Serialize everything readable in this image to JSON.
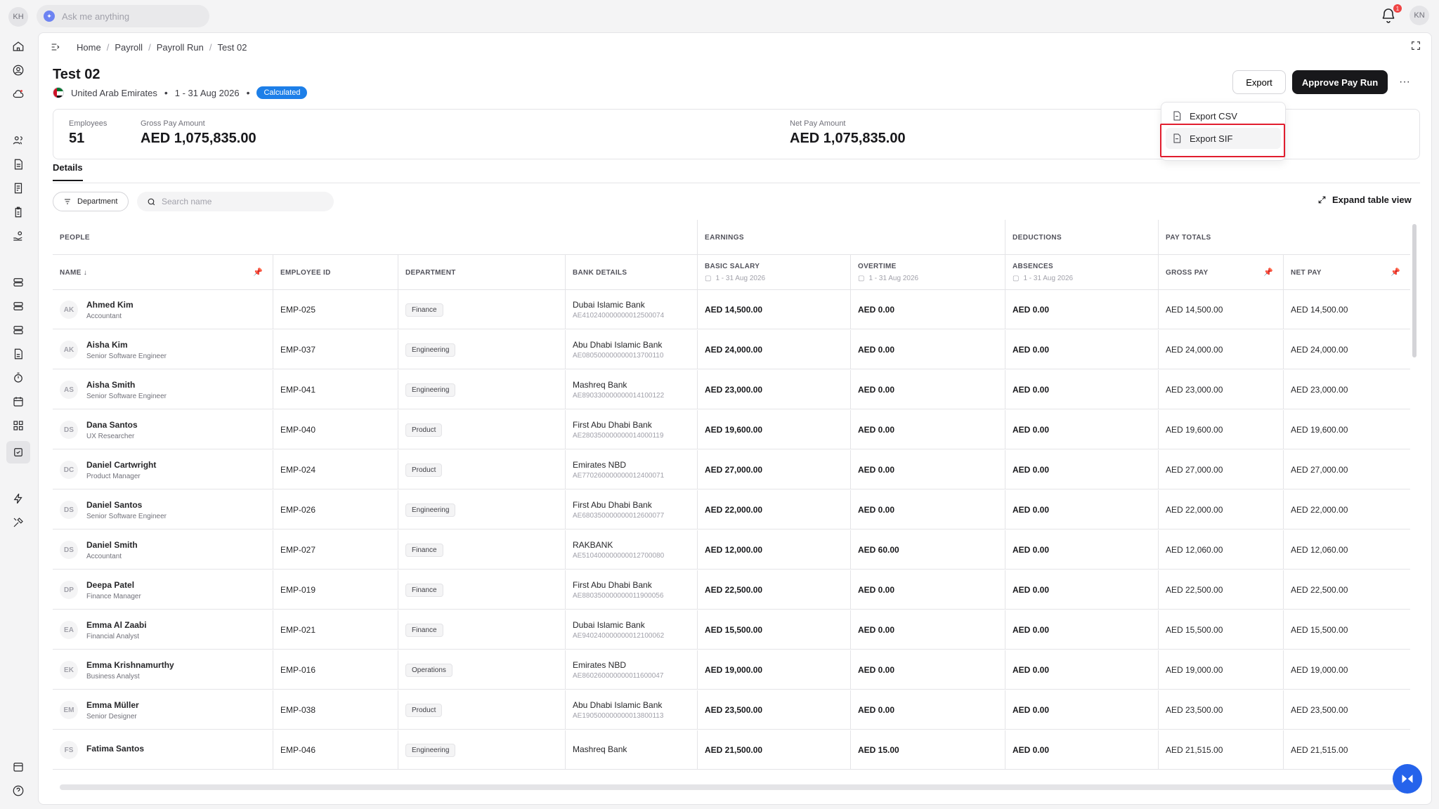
{
  "topbar": {
    "user_initials_left": "KH",
    "ask_placeholder": "Ask me anything",
    "notifications_count": "1",
    "user_initials_right": "KN"
  },
  "breadcrumb": [
    "Home",
    "Payroll",
    "Payroll Run",
    "Test 02"
  ],
  "page": {
    "title": "Test 02",
    "country": "United Arab Emirates",
    "period": "1 - 31 Aug 2026",
    "status": "Calculated"
  },
  "actions": {
    "export": "Export",
    "approve": "Approve Pay Run",
    "more": "···"
  },
  "export_menu": {
    "items": [
      {
        "label": "Export CSV"
      },
      {
        "label": "Export SIF"
      }
    ]
  },
  "summary": {
    "employees_label": "Employees",
    "employees_value": "51",
    "gross_label": "Gross Pay Amount",
    "gross_value": "AED 1,075,835.00",
    "net_label": "Net Pay Amount",
    "net_value": "AED 1,075,835.00"
  },
  "tabs": [
    "Details"
  ],
  "filters": {
    "department": "Department",
    "search_placeholder": "Search name",
    "expand": "Expand table view"
  },
  "table": {
    "groups": [
      "PEOPLE",
      "EARNINGS",
      "DEDUCTIONS",
      "PAY TOTALS"
    ],
    "headers": {
      "name": "NAME",
      "employee_id": "EMPLOYEE ID",
      "department": "DEPARTMENT",
      "bank": "BANK DETAILS",
      "basic_salary": "BASIC SALARY",
      "overtime": "OVERTIME",
      "absences": "ABSENCES",
      "gross_pay": "GROSS PAY",
      "net_pay": "NET PAY",
      "period_sub": "1 - 31 Aug 2026"
    },
    "rows": [
      {
        "initials": "AK",
        "name": "Ahmed Kim",
        "role": "Accountant",
        "id": "EMP-025",
        "dept": "Finance",
        "bank": "Dubai Islamic Bank",
        "iban": "AE410240000000012500074",
        "basic": "AED 14,500.00",
        "overtime": "AED 0.00",
        "absences": "AED 0.00",
        "gross": "AED 14,500.00",
        "net": "AED 14,500.00"
      },
      {
        "initials": "AK",
        "name": "Aisha Kim",
        "role": "Senior Software Engineer",
        "id": "EMP-037",
        "dept": "Engineering",
        "bank": "Abu Dhabi Islamic Bank",
        "iban": "AE080500000000013700110",
        "basic": "AED 24,000.00",
        "overtime": "AED 0.00",
        "absences": "AED 0.00",
        "gross": "AED 24,000.00",
        "net": "AED 24,000.00"
      },
      {
        "initials": "AS",
        "name": "Aisha Smith",
        "role": "Senior Software Engineer",
        "id": "EMP-041",
        "dept": "Engineering",
        "bank": "Mashreq Bank",
        "iban": "AE890330000000014100122",
        "basic": "AED 23,000.00",
        "overtime": "AED 0.00",
        "absences": "AED 0.00",
        "gross": "AED 23,000.00",
        "net": "AED 23,000.00"
      },
      {
        "initials": "DS",
        "name": "Dana Santos",
        "role": "UX Researcher",
        "id": "EMP-040",
        "dept": "Product",
        "bank": "First Abu Dhabi Bank",
        "iban": "AE280350000000014000119",
        "basic": "AED 19,600.00",
        "overtime": "AED 0.00",
        "absences": "AED 0.00",
        "gross": "AED 19,600.00",
        "net": "AED 19,600.00"
      },
      {
        "initials": "DC",
        "name": "Daniel Cartwright",
        "role": "Product Manager",
        "id": "EMP-024",
        "dept": "Product",
        "bank": "Emirates NBD",
        "iban": "AE770260000000012400071",
        "basic": "AED 27,000.00",
        "overtime": "AED 0.00",
        "absences": "AED 0.00",
        "gross": "AED 27,000.00",
        "net": "AED 27,000.00"
      },
      {
        "initials": "DS",
        "name": "Daniel Santos",
        "role": "Senior Software Engineer",
        "id": "EMP-026",
        "dept": "Engineering",
        "bank": "First Abu Dhabi Bank",
        "iban": "AE680350000000012600077",
        "basic": "AED 22,000.00",
        "overtime": "AED 0.00",
        "absences": "AED 0.00",
        "gross": "AED 22,000.00",
        "net": "AED 22,000.00"
      },
      {
        "initials": "DS",
        "name": "Daniel Smith",
        "role": "Accountant",
        "id": "EMP-027",
        "dept": "Finance",
        "bank": "RAKBANK",
        "iban": "AE510400000000012700080",
        "basic": "AED 12,000.00",
        "overtime": "AED 60.00",
        "absences": "AED 0.00",
        "gross": "AED 12,060.00",
        "net": "AED 12,060.00"
      },
      {
        "initials": "DP",
        "name": "Deepa Patel",
        "role": "Finance Manager",
        "id": "EMP-019",
        "dept": "Finance",
        "bank": "First Abu Dhabi Bank",
        "iban": "AE880350000000011900056",
        "basic": "AED 22,500.00",
        "overtime": "AED 0.00",
        "absences": "AED 0.00",
        "gross": "AED 22,500.00",
        "net": "AED 22,500.00"
      },
      {
        "initials": "EA",
        "name": "Emma Al Zaabi",
        "role": "Financial Analyst",
        "id": "EMP-021",
        "dept": "Finance",
        "bank": "Dubai Islamic Bank",
        "iban": "AE940240000000012100062",
        "basic": "AED 15,500.00",
        "overtime": "AED 0.00",
        "absences": "AED 0.00",
        "gross": "AED 15,500.00",
        "net": "AED 15,500.00"
      },
      {
        "initials": "EK",
        "name": "Emma Krishnamurthy",
        "role": "Business Analyst",
        "id": "EMP-016",
        "dept": "Operations",
        "bank": "Emirates NBD",
        "iban": "AE860260000000011600047",
        "basic": "AED 19,000.00",
        "overtime": "AED 0.00",
        "absences": "AED 0.00",
        "gross": "AED 19,000.00",
        "net": "AED 19,000.00"
      },
      {
        "initials": "EM",
        "name": "Emma Müller",
        "role": "Senior Designer",
        "id": "EMP-038",
        "dept": "Product",
        "bank": "Abu Dhabi Islamic Bank",
        "iban": "AE190500000000013800113",
        "basic": "AED 23,500.00",
        "overtime": "AED 0.00",
        "absences": "AED 0.00",
        "gross": "AED 23,500.00",
        "net": "AED 23,500.00"
      },
      {
        "initials": "FS",
        "name": "Fatima Santos",
        "role": "",
        "id": "EMP-046",
        "dept": "Engineering",
        "bank": "Mashreq Bank",
        "iban": "",
        "basic": "AED 21,500.00",
        "overtime": "AED 15.00",
        "absences": "AED 0.00",
        "gross": "AED 21,515.00",
        "net": "AED 21,515.00"
      }
    ]
  },
  "icons": {
    "rail": [
      "home-icon",
      "user-circle-icon",
      "cloud-alert-icon",
      "users-icon",
      "document-icon",
      "notes-icon",
      "clipboard-icon",
      "hand-coins-icon",
      "server-icon",
      "server-icon",
      "server-icon",
      "file-icon",
      "timer-icon",
      "calendar-icon",
      "grid-icon",
      "check-square-icon",
      "bolt-icon",
      "tools-icon",
      "calendar-grid-icon",
      "help-icon"
    ]
  },
  "colors": {
    "status_badge": "#1d7fe8",
    "approve_button": "#18181b",
    "highlight": "#e11d2e",
    "fab": "#2563eb"
  }
}
